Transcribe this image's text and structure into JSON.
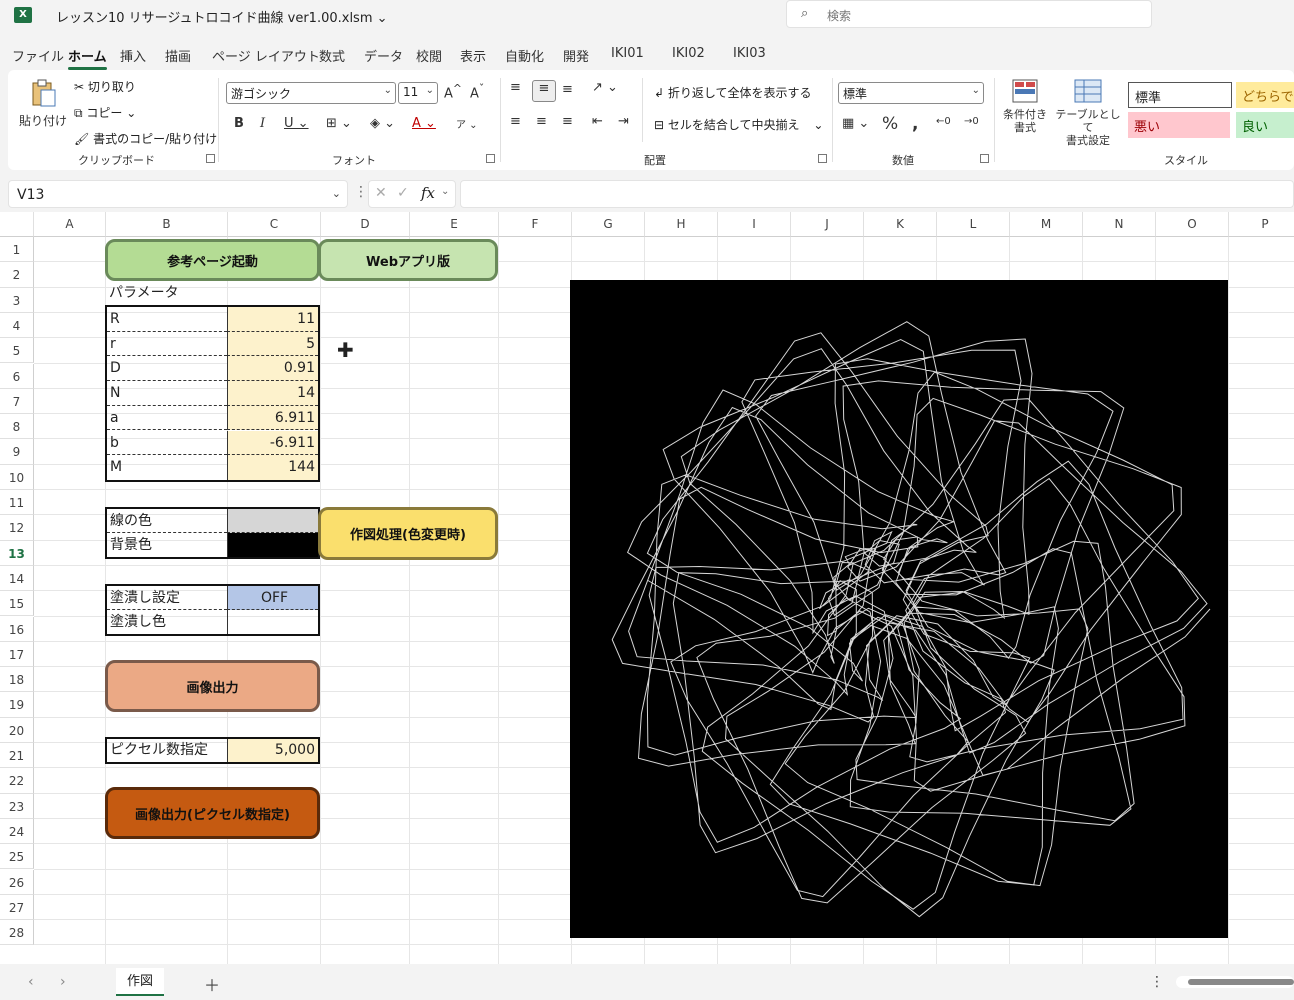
{
  "window": {
    "title": "レッスン10 リサージュトロコイド曲線 ver1.00.xlsm ⌄",
    "search_placeholder": "検索"
  },
  "menu_tabs": [
    "ファイル",
    "ホーム",
    "挿入",
    "描画",
    "ページ レイアウト",
    "数式",
    "データ",
    "校閲",
    "表示",
    "自動化",
    "開発",
    "IKI01",
    "IKI02",
    "IKI03"
  ],
  "ribbon": {
    "clipboard": {
      "paste": "貼り付け",
      "cut": "切り取り",
      "copy": "コピー",
      "format_painter": "書式のコピー/貼り付け",
      "label": "クリップボード"
    },
    "font": {
      "name": "游ゴシック",
      "size": "11",
      "label": "フォント"
    },
    "alignment": {
      "wrap": "折り返して全体を表示する",
      "merge": "セルを結合して中央揃え",
      "label": "配置"
    },
    "number": {
      "format": "標準",
      "label": "数値"
    },
    "styles": {
      "conditional": "条件付き\n書式",
      "table": "テーブルとして\n書式設定",
      "normal": "標準",
      "neutral": "どちらで",
      "bad": "悪い",
      "good": "良い",
      "label": "スタイル"
    }
  },
  "formula_bar": {
    "name_box": "V13",
    "formula": ""
  },
  "columns": [
    "A",
    "B",
    "C",
    "D",
    "E",
    "F",
    "G",
    "H",
    "I",
    "J",
    "K",
    "L",
    "M",
    "N",
    "O",
    "P"
  ],
  "rows": [
    "1",
    "2",
    "3",
    "4",
    "5",
    "6",
    "7",
    "8",
    "9",
    "10",
    "11",
    "12",
    "13",
    "14",
    "15",
    "16",
    "17",
    "18",
    "19",
    "20",
    "21",
    "22",
    "23",
    "24",
    "25",
    "26",
    "27",
    "28"
  ],
  "sheet": {
    "btn_ref": "参考ページ起動",
    "btn_web": "Webアプリ版",
    "param_header": "パラメータ",
    "params": [
      {
        "name": "R",
        "value": "11"
      },
      {
        "name": "r",
        "value": "5"
      },
      {
        "name": "D",
        "value": "0.91"
      },
      {
        "name": "N",
        "value": "14"
      },
      {
        "name": "a",
        "value": "6.911"
      },
      {
        "name": "b",
        "value": "-6.911"
      },
      {
        "name": "M",
        "value": "144"
      }
    ],
    "line_color_label": "線の色",
    "bg_color_label": "背景色",
    "btn_draw": "作図処理(色変更時)",
    "fill_setting_label": "塗潰し設定",
    "fill_setting_value": "OFF",
    "fill_color_label": "塗潰し色",
    "btn_export": "画像出力",
    "pixel_label": "ピクセル数指定",
    "pixel_value": "5,000",
    "btn_export_px": "画像出力(ピクセル数指定)"
  },
  "sheet_tabs": [
    "作図"
  ],
  "colors": {
    "line": "#d6d6d6",
    "background": "#000000",
    "green_btn": "#b4dc94",
    "yellow_btn": "#fadf6d",
    "salmon_btn": "#eba985",
    "brown_btn": "#c55a11",
    "param_fill": "#fdf2cc",
    "off_fill": "#b4c6e7"
  }
}
